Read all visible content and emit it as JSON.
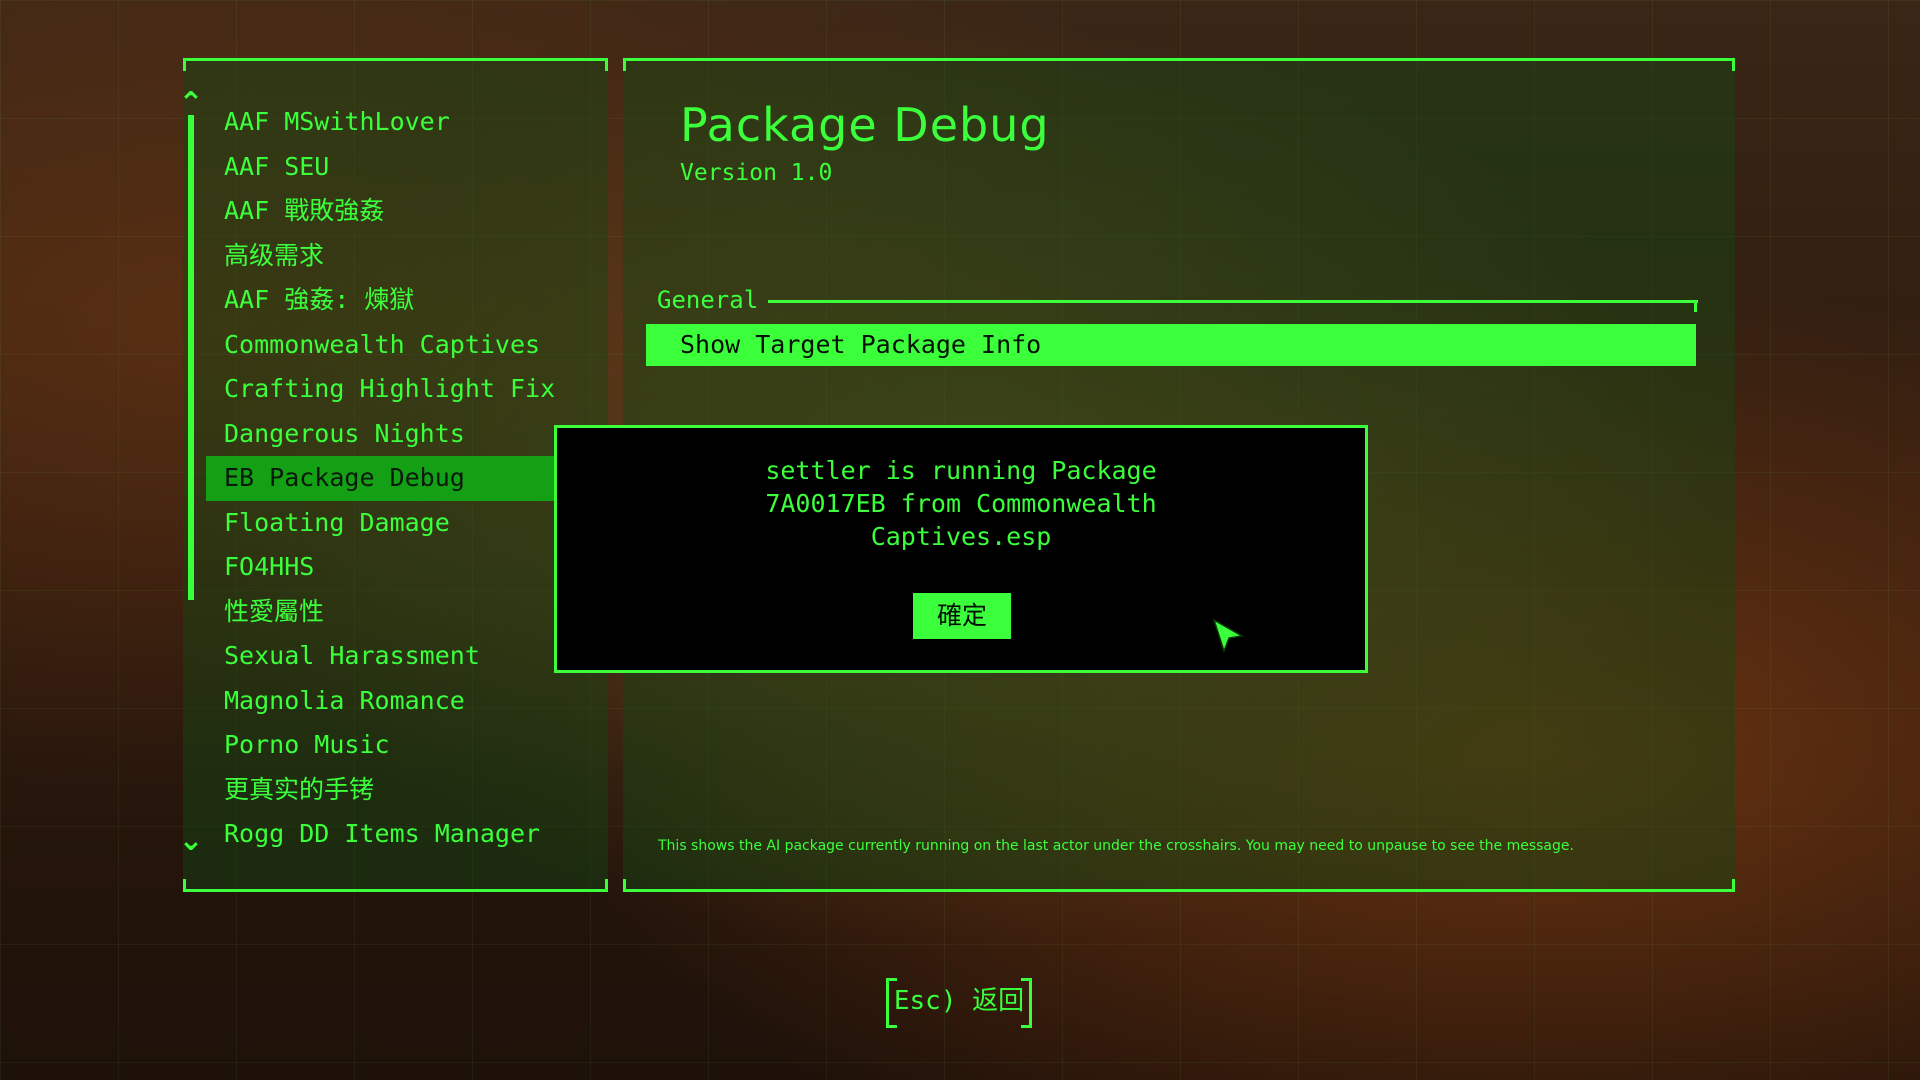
{
  "mod_list": {
    "items": [
      "AAF MSwithLover",
      "AAF SEU",
      "AAF 戰敗強姦",
      "高级需求",
      "AAF 強姦: 煉獄",
      "Commonwealth Captives",
      "Crafting Highlight Fix",
      "Dangerous Nights",
      "EB Package Debug",
      "Floating Damage",
      "FO4HHS",
      "性愛屬性",
      "Sexual Harassment",
      "Magnolia Romance",
      "Porno Music",
      "更真实的手铐",
      "Rogg DD Items Manager"
    ],
    "selected_index": 8
  },
  "mod_page": {
    "title": "Package Debug",
    "version": "Version 1.0",
    "section": "General",
    "option": "Show Target Package Info",
    "help_text": "This shows the AI package currently running on the last actor under the crosshairs. You may need to unpause to see the message."
  },
  "dialog": {
    "lines": [
      "settler is running Package",
      "7A0017EB from Commonwealth",
      "Captives.esp"
    ],
    "ok_label": "確定"
  },
  "footer": {
    "back_label": "Esc) 返回"
  },
  "icons": {
    "scroll_up": "chevron-up-icon",
    "scroll_down": "chevron-down-icon",
    "cursor": "mouse-cursor-icon"
  },
  "colors": {
    "pipboy_green": "#3cff3c",
    "selected_bg": "#14a014",
    "dialog_bg": "#000000"
  }
}
